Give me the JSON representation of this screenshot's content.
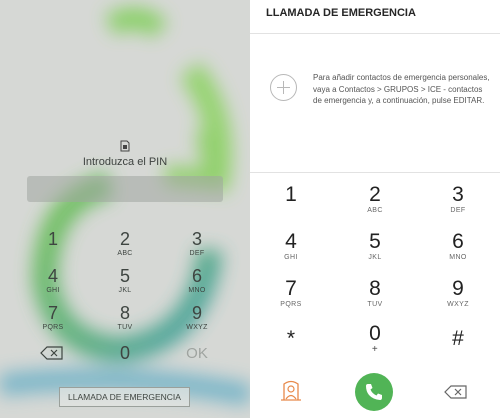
{
  "lock_screen": {
    "pin_prompt": "Introduzca el PIN",
    "keys": [
      {
        "digit": "1",
        "letters": ""
      },
      {
        "digit": "2",
        "letters": "ABC"
      },
      {
        "digit": "3",
        "letters": "DEF"
      },
      {
        "digit": "4",
        "letters": "GHI"
      },
      {
        "digit": "5",
        "letters": "JKL"
      },
      {
        "digit": "6",
        "letters": "MNO"
      },
      {
        "digit": "7",
        "letters": "PQRS"
      },
      {
        "digit": "8",
        "letters": "TUV"
      },
      {
        "digit": "9",
        "letters": "WXYZ"
      },
      {
        "digit": "0",
        "letters": ""
      }
    ],
    "ok_label": "OK",
    "emergency_button": "LLAMADA DE EMERGENCIA",
    "icons": {
      "sim": "sim-card-icon",
      "delete": "backspace-icon"
    }
  },
  "emergency_dialer": {
    "title": "LLAMADA DE EMERGENCIA",
    "info_text": "Para añadir contactos de emergencia personales, vaya a Contactos > GRUPOS > ICE - contactos de emergencia y, a continuación, pulse EDITAR.",
    "keys": [
      {
        "digit": "1",
        "letters": ""
      },
      {
        "digit": "2",
        "letters": "ABC"
      },
      {
        "digit": "3",
        "letters": "DEF"
      },
      {
        "digit": "4",
        "letters": "GHI"
      },
      {
        "digit": "5",
        "letters": "JKL"
      },
      {
        "digit": "6",
        "letters": "MNO"
      },
      {
        "digit": "7",
        "letters": "PQRS"
      },
      {
        "digit": "8",
        "letters": "TUV"
      },
      {
        "digit": "9",
        "letters": "WXYZ"
      },
      {
        "digit": "*",
        "letters": ""
      },
      {
        "digit": "0",
        "letters": "+"
      },
      {
        "digit": "#",
        "letters": ""
      }
    ],
    "icons": {
      "add": "add-contact-icon",
      "ice": "ice-contact-icon",
      "call": "phone-icon",
      "delete": "backspace-icon"
    },
    "colors": {
      "call": "#51b456",
      "ice_icon": "#e8894a"
    }
  }
}
